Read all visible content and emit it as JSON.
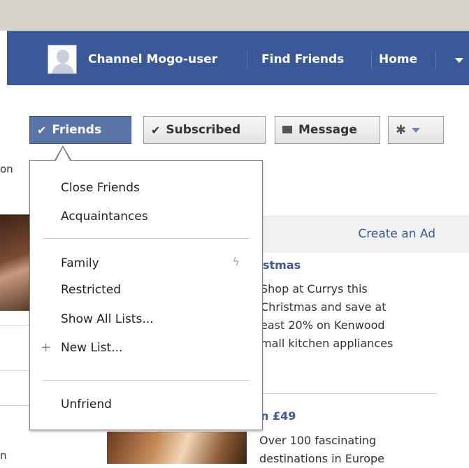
{
  "topnav": {
    "user_name": "Channel Mogo-user",
    "find_friends": "Find Friends",
    "home": "Home"
  },
  "actions": {
    "friends_label": "Friends",
    "subscribed_label": "Subscribed",
    "message_label": "Message"
  },
  "background": {
    "partial_on": "on",
    "partial_bottom": "n"
  },
  "ads": {
    "create_ad": "Create an Ad",
    "ad1": {
      "title": "stmas",
      "lines": [
        "Shop at Currys this",
        "Christmas and save at",
        "east 20% on Kenwood",
        "mall kitchen appliances"
      ]
    },
    "ad2": {
      "title": "n £49",
      "lines": [
        "Over 100 fascinating",
        "destinations in Europe"
      ]
    }
  },
  "friends_menu": {
    "items": {
      "close_friends": "Close Friends",
      "acquaintances": "Acquaintances",
      "family": "Family",
      "restricted": "Restricted",
      "show_all_lists": "Show All Lists...",
      "new_list": "New List...",
      "unfriend": "Unfriend"
    }
  },
  "colors": {
    "brand": "#3b5998",
    "friends_button": "#5b74a8"
  },
  "icons": {
    "check": "check-icon",
    "message": "message-icon",
    "gear": "gear-icon",
    "plus": "plus-icon",
    "bolt": "lightning-icon"
  }
}
